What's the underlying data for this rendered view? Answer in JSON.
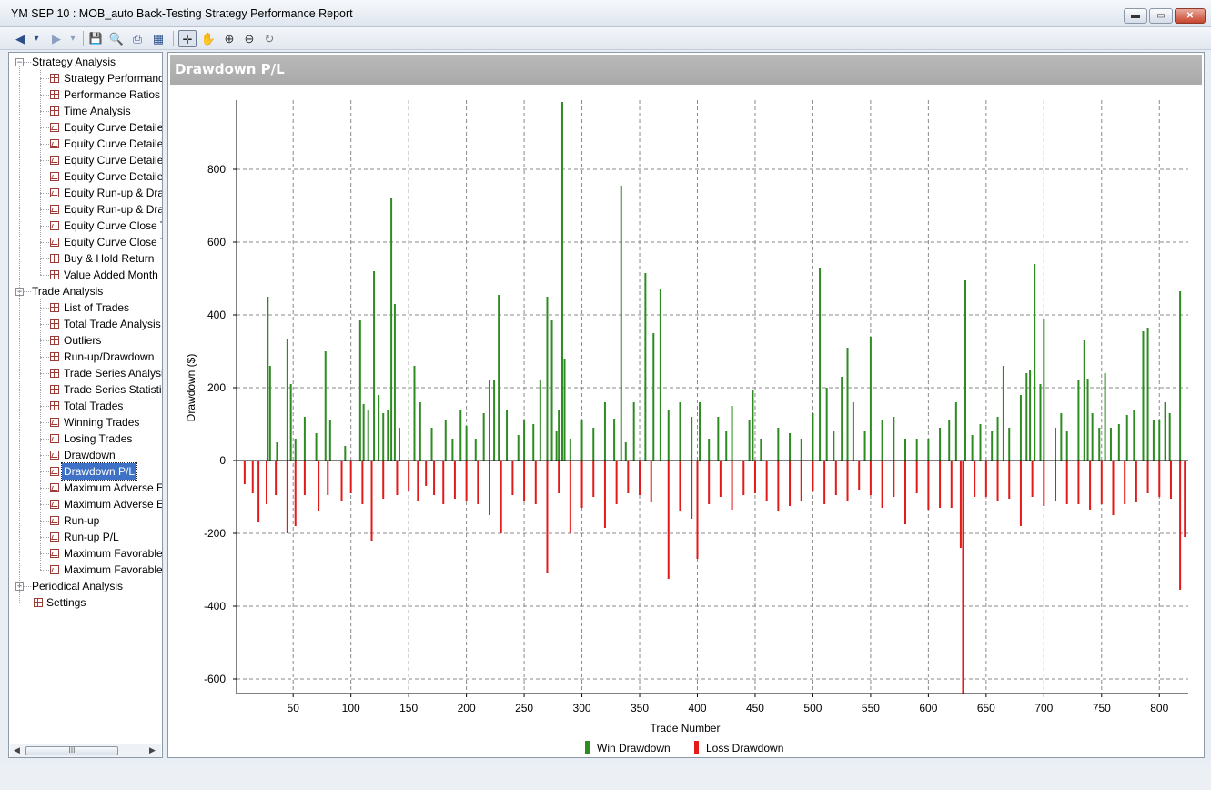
{
  "window": {
    "title": "YM  SEP 10 : MOB_auto Back-Testing Strategy Performance Report",
    "minimize": "▬",
    "restore": "▭",
    "close": "✕"
  },
  "toolbar": {
    "back": "◀",
    "back_drop": "▾",
    "forward": "▶",
    "forward_drop": "▾",
    "save": "💾",
    "preview": "🔍",
    "print": "⎙",
    "layout": "▦",
    "crosshair": "✛",
    "pan": "✋",
    "zoom_in": "⊕",
    "zoom_out": "⊖",
    "reset": "↻"
  },
  "tree": {
    "groups": [
      {
        "label": "Strategy Analysis",
        "expanded": true,
        "items": [
          {
            "label": "Strategy Performanc",
            "icon": "grid"
          },
          {
            "label": "Performance Ratios",
            "icon": "grid"
          },
          {
            "label": "Time Analysis",
            "icon": "grid"
          },
          {
            "label": "Equity Curve Detaile",
            "icon": "line"
          },
          {
            "label": "Equity Curve Detaile",
            "icon": "line"
          },
          {
            "label": "Equity Curve Detaile",
            "icon": "line"
          },
          {
            "label": "Equity Curve Detaile",
            "icon": "line"
          },
          {
            "label": "Equity Run-up & Dra",
            "icon": "line"
          },
          {
            "label": "Equity Run-up & Dra",
            "icon": "line"
          },
          {
            "label": "Equity Curve Close T",
            "icon": "line"
          },
          {
            "label": "Equity Curve Close T",
            "icon": "line"
          },
          {
            "label": "Buy & Hold Return",
            "icon": "grid"
          },
          {
            "label": "Value Added Month",
            "icon": "grid"
          }
        ]
      },
      {
        "label": "Trade Analysis",
        "expanded": true,
        "items": [
          {
            "label": "List of Trades",
            "icon": "grid"
          },
          {
            "label": "Total Trade Analysis",
            "icon": "grid"
          },
          {
            "label": "Outliers",
            "icon": "grid"
          },
          {
            "label": "Run-up/Drawdown",
            "icon": "grid"
          },
          {
            "label": "Trade Series Analysis",
            "icon": "grid"
          },
          {
            "label": "Trade Series Statistic",
            "icon": "grid"
          },
          {
            "label": "Total Trades",
            "icon": "grid"
          },
          {
            "label": "Winning Trades",
            "icon": "line"
          },
          {
            "label": "Losing Trades",
            "icon": "line"
          },
          {
            "label": "Drawdown",
            "icon": "line"
          },
          {
            "label": "Drawdown P/L",
            "icon": "line",
            "selected": true
          },
          {
            "label": "Maximum Adverse E",
            "icon": "line"
          },
          {
            "label": "Maximum Adverse E",
            "icon": "line"
          },
          {
            "label": "Run-up",
            "icon": "line"
          },
          {
            "label": "Run-up P/L",
            "icon": "line"
          },
          {
            "label": "Maximum Favorable",
            "icon": "line"
          },
          {
            "label": "Maximum Favorable",
            "icon": "line"
          }
        ]
      },
      {
        "label": "Periodical Analysis",
        "expanded": false,
        "items": []
      }
    ],
    "settings": "Settings",
    "scroll_thumb": "III",
    "scroll_left": "◀",
    "scroll_right": "▶"
  },
  "panel": {
    "title": "Drawdown P/L"
  },
  "chart_data": {
    "type": "bar",
    "xlabel": "Trade Number",
    "ylabel": "Drawdown ($)",
    "xlim": [
      1,
      825
    ],
    "ylim": [
      -640,
      990
    ],
    "xticks": [
      50,
      100,
      150,
      200,
      250,
      300,
      350,
      400,
      450,
      500,
      550,
      600,
      650,
      700,
      750,
      800
    ],
    "yticks": [
      -600,
      -400,
      -200,
      0,
      200,
      400,
      600,
      800
    ],
    "grid": true,
    "legend_position": "bottom-center",
    "series": [
      {
        "name": "Win Drawdown",
        "color": "#2e8b22",
        "points": [
          [
            28,
            450
          ],
          [
            30,
            260
          ],
          [
            36,
            50
          ],
          [
            45,
            335
          ],
          [
            48,
            210
          ],
          [
            52,
            60
          ],
          [
            60,
            120
          ],
          [
            70,
            75
          ],
          [
            78,
            300
          ],
          [
            82,
            110
          ],
          [
            95,
            40
          ],
          [
            108,
            385
          ],
          [
            111,
            155
          ],
          [
            115,
            140
          ],
          [
            120,
            520
          ],
          [
            124,
            180
          ],
          [
            128,
            130
          ],
          [
            132,
            140
          ],
          [
            135,
            720
          ],
          [
            138,
            430
          ],
          [
            142,
            90
          ],
          [
            155,
            260
          ],
          [
            160,
            160
          ],
          [
            170,
            90
          ],
          [
            182,
            110
          ],
          [
            188,
            60
          ],
          [
            195,
            140
          ],
          [
            200,
            95
          ],
          [
            208,
            60
          ],
          [
            215,
            130
          ],
          [
            220,
            220
          ],
          [
            224,
            220
          ],
          [
            228,
            455
          ],
          [
            235,
            140
          ],
          [
            245,
            70
          ],
          [
            250,
            110
          ],
          [
            258,
            100
          ],
          [
            264,
            220
          ],
          [
            270,
            450
          ],
          [
            274,
            385
          ],
          [
            278,
            80
          ],
          [
            280,
            140
          ],
          [
            283,
            985
          ],
          [
            285,
            280
          ],
          [
            290,
            60
          ],
          [
            300,
            110
          ],
          [
            310,
            90
          ],
          [
            320,
            160
          ],
          [
            328,
            115
          ],
          [
            334,
            755
          ],
          [
            338,
            50
          ],
          [
            345,
            160
          ],
          [
            355,
            515
          ],
          [
            362,
            350
          ],
          [
            368,
            470
          ],
          [
            375,
            140
          ],
          [
            385,
            160
          ],
          [
            395,
            120
          ],
          [
            402,
            160
          ],
          [
            410,
            60
          ],
          [
            418,
            120
          ],
          [
            425,
            80
          ],
          [
            430,
            150
          ],
          [
            445,
            110
          ],
          [
            448,
            195
          ],
          [
            455,
            60
          ],
          [
            470,
            90
          ],
          [
            480,
            75
          ],
          [
            490,
            60
          ],
          [
            500,
            130
          ],
          [
            506,
            530
          ],
          [
            512,
            200
          ],
          [
            518,
            80
          ],
          [
            525,
            230
          ],
          [
            530,
            310
          ],
          [
            535,
            160
          ],
          [
            545,
            80
          ],
          [
            550,
            340
          ],
          [
            560,
            110
          ],
          [
            570,
            120
          ],
          [
            580,
            60
          ],
          [
            590,
            60
          ],
          [
            600,
            60
          ],
          [
            610,
            90
          ],
          [
            618,
            110
          ],
          [
            624,
            160
          ],
          [
            632,
            495
          ],
          [
            638,
            70
          ],
          [
            645,
            100
          ],
          [
            655,
            80
          ],
          [
            660,
            120
          ],
          [
            665,
            260
          ],
          [
            670,
            90
          ],
          [
            680,
            180
          ],
          [
            685,
            240
          ],
          [
            688,
            250
          ],
          [
            692,
            540
          ],
          [
            697,
            210
          ],
          [
            700,
            390
          ],
          [
            710,
            90
          ],
          [
            715,
            130
          ],
          [
            720,
            80
          ],
          [
            730,
            220
          ],
          [
            735,
            330
          ],
          [
            738,
            225
          ],
          [
            742,
            130
          ],
          [
            748,
            90
          ],
          [
            753,
            240
          ],
          [
            758,
            90
          ],
          [
            765,
            100
          ],
          [
            772,
            125
          ],
          [
            778,
            140
          ],
          [
            786,
            355
          ],
          [
            790,
            365
          ],
          [
            795,
            110
          ],
          [
            800,
            110
          ],
          [
            805,
            160
          ],
          [
            809,
            130
          ],
          [
            818,
            465
          ]
        ]
      },
      {
        "name": "Loss Drawdown",
        "color": "#e31a1a",
        "points": [
          [
            8,
            -65
          ],
          [
            15,
            -90
          ],
          [
            20,
            -170
          ],
          [
            27,
            -120
          ],
          [
            35,
            -95
          ],
          [
            45,
            -200
          ],
          [
            52,
            -180
          ],
          [
            60,
            -95
          ],
          [
            72,
            -140
          ],
          [
            80,
            -95
          ],
          [
            92,
            -110
          ],
          [
            100,
            -90
          ],
          [
            110,
            -120
          ],
          [
            118,
            -220
          ],
          [
            128,
            -105
          ],
          [
            140,
            -95
          ],
          [
            150,
            -85
          ],
          [
            158,
            -110
          ],
          [
            165,
            -70
          ],
          [
            172,
            -95
          ],
          [
            180,
            -120
          ],
          [
            190,
            -105
          ],
          [
            200,
            -110
          ],
          [
            210,
            -120
          ],
          [
            220,
            -150
          ],
          [
            230,
            -200
          ],
          [
            240,
            -95
          ],
          [
            250,
            -110
          ],
          [
            260,
            -120
          ],
          [
            270,
            -310
          ],
          [
            280,
            -90
          ],
          [
            290,
            -200
          ],
          [
            300,
            -130
          ],
          [
            310,
            -100
          ],
          [
            320,
            -185
          ],
          [
            330,
            -120
          ],
          [
            340,
            -90
          ],
          [
            350,
            -95
          ],
          [
            360,
            -115
          ],
          [
            375,
            -325
          ],
          [
            385,
            -140
          ],
          [
            395,
            -160
          ],
          [
            400,
            -270
          ],
          [
            410,
            -120
          ],
          [
            420,
            -100
          ],
          [
            430,
            -135
          ],
          [
            440,
            -95
          ],
          [
            450,
            -90
          ],
          [
            460,
            -110
          ],
          [
            470,
            -140
          ],
          [
            480,
            -125
          ],
          [
            490,
            -110
          ],
          [
            500,
            -85
          ],
          [
            510,
            -120
          ],
          [
            520,
            -95
          ],
          [
            530,
            -110
          ],
          [
            540,
            -80
          ],
          [
            550,
            -95
          ],
          [
            560,
            -130
          ],
          [
            570,
            -100
          ],
          [
            580,
            -175
          ],
          [
            590,
            -90
          ],
          [
            600,
            -135
          ],
          [
            610,
            -130
          ],
          [
            620,
            -130
          ],
          [
            628,
            -240
          ],
          [
            630,
            -640
          ],
          [
            640,
            -100
          ],
          [
            650,
            -100
          ],
          [
            660,
            -110
          ],
          [
            670,
            -105
          ],
          [
            680,
            -180
          ],
          [
            690,
            -100
          ],
          [
            700,
            -125
          ],
          [
            710,
            -110
          ],
          [
            720,
            -120
          ],
          [
            730,
            -120
          ],
          [
            740,
            -135
          ],
          [
            750,
            -120
          ],
          [
            760,
            -150
          ],
          [
            770,
            -120
          ],
          [
            780,
            -115
          ],
          [
            790,
            -90
          ],
          [
            800,
            -100
          ],
          [
            810,
            -105
          ],
          [
            818,
            -355
          ],
          [
            822,
            -210
          ]
        ]
      }
    ]
  }
}
